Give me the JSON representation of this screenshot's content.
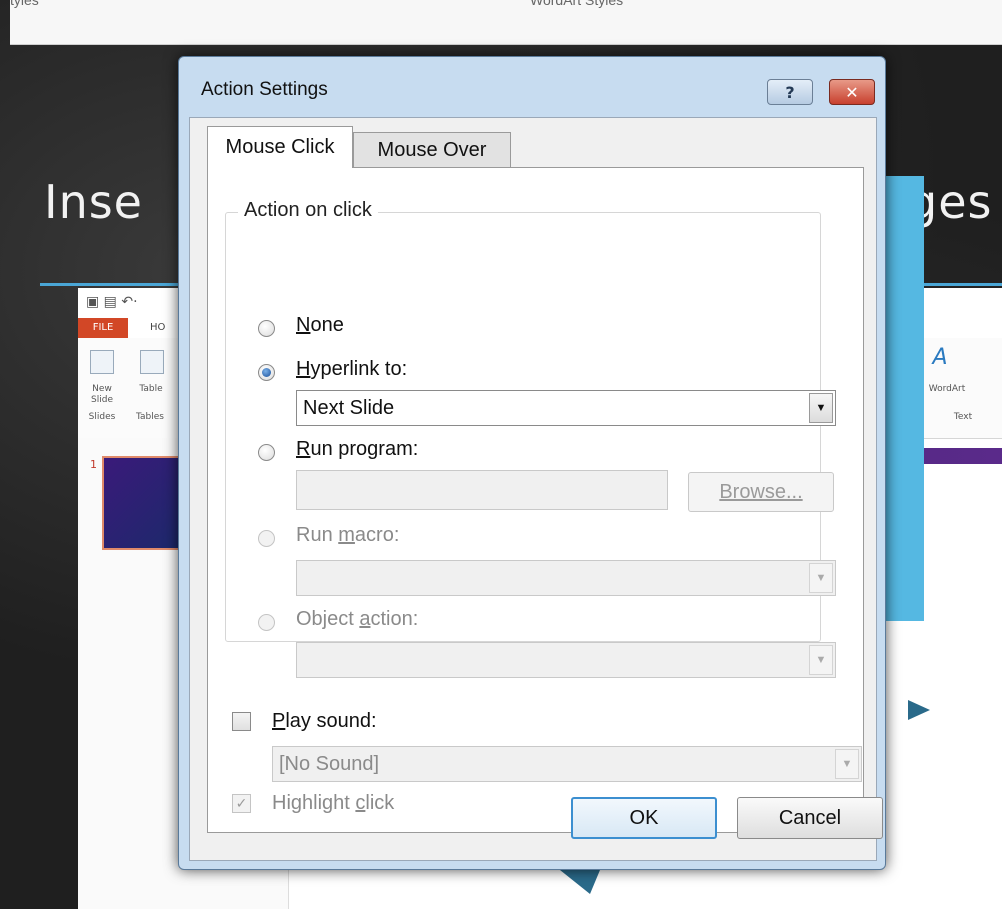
{
  "background": {
    "ribbon_labels": [
      "tyles",
      "WordArt Styles"
    ],
    "slide_title_left": "Inse",
    "slide_title_right": "ges",
    "powerpoint": {
      "file_tab": "FILE",
      "home_tab_partial": "HO",
      "new_slide": "New Slide",
      "slides_group": "Slides",
      "table": "Table",
      "tables_group": "Tables",
      "wordart": "WordArt",
      "text_group": "Text",
      "slide_number": "1"
    }
  },
  "dialog": {
    "title": "Action Settings",
    "help_label": "?",
    "close_label": "✕",
    "tabs": [
      {
        "label": "Mouse Click",
        "active": true
      },
      {
        "label": "Mouse Over",
        "active": false
      }
    ],
    "group_title": "Action on click",
    "options": {
      "none": {
        "pre": "",
        "key": "N",
        "post": "one"
      },
      "hyperlink": {
        "pre": "",
        "key": "H",
        "post": "yperlink to:"
      },
      "run_program": {
        "pre": "",
        "key": "R",
        "post": "un program:"
      },
      "run_macro": {
        "pre": "Run ",
        "key": "m",
        "post": "acro:"
      },
      "object_action": {
        "pre": "Object ",
        "key": "a",
        "post": "ction:"
      }
    },
    "hyperlink_value": "Next Slide",
    "browse_label": "Browse...",
    "play_sound": {
      "pre": "",
      "key": "P",
      "post": "lay sound:"
    },
    "sound_value": "[No Sound]",
    "highlight_click": {
      "pre": "Highlight ",
      "key": "c",
      "post": "lick"
    },
    "ok_label": "OK",
    "cancel_label": "Cancel"
  }
}
